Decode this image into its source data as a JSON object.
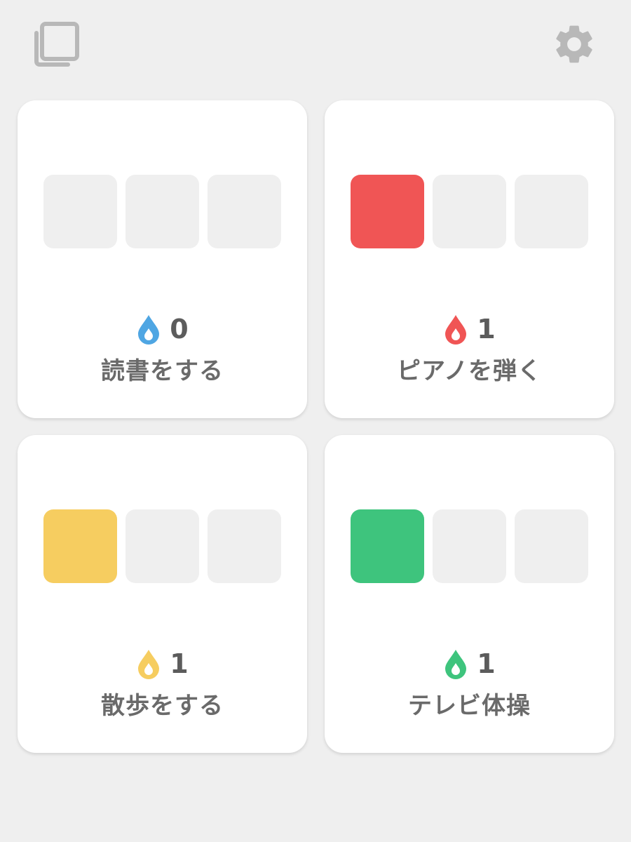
{
  "toolbar": {
    "left_icon": "copy-icon",
    "right_icon": "gear-icon",
    "icon_color": "#b8b8b8"
  },
  "cards": [
    {
      "name": "読書をする",
      "count": "0",
      "color": "#4fa6e3",
      "filled": 0,
      "total": 3
    },
    {
      "name": "ピアノを弾く",
      "count": "1",
      "color": "#f05555",
      "filled": 1,
      "total": 3
    },
    {
      "name": "散歩をする",
      "count": "1",
      "color": "#f6cd60",
      "filled": 1,
      "total": 3
    },
    {
      "name": "テレビ体操",
      "count": "1",
      "color": "#3ec47d",
      "filled": 1,
      "total": 3
    }
  ],
  "colors": {
    "background": "#efefef",
    "card": "#ffffff",
    "empty_box": "#efefef",
    "text": "#6a6a6a"
  }
}
